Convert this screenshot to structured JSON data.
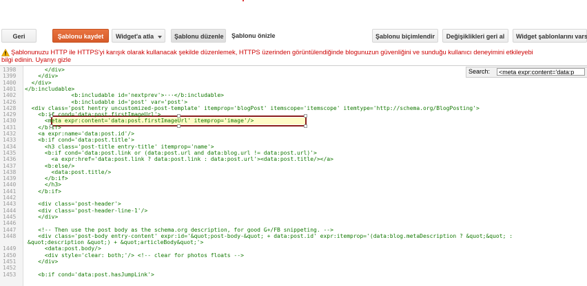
{
  "toolbar": {
    "back": "Geri",
    "save": "Şablonu kaydet",
    "widget_jump": "Widget'a atla",
    "edit_template": "Şablonu düzenle",
    "preview_template": "Şablonu önizle",
    "format_template": "Şablonu biçimlendir",
    "revert_changes": "Değişiklikleri geri al",
    "widget_templates": "Widget şablonlarını varsa"
  },
  "warning": {
    "line1": "Şablonunuzu HTTP ile HTTPS'yi karışık olarak kullanacak şekilde düzenlemek, HTTPS üzerinden görüntülendiğinde blogunuzun güvenliğini ve sunduğu kullanıcı deneyimini etkileyebi",
    "line2": "bilgi edinin.",
    "link": "Uyarıyı gizle"
  },
  "search": {
    "label": "Search:",
    "value": "<meta expr:content='data:p"
  },
  "code": [
    {
      "n": "1398",
      "t": "      </div>"
    },
    {
      "n": "1399",
      "t": "    </div>"
    },
    {
      "n": "1400",
      "t": "  </div>"
    },
    {
      "n": "1401",
      "t": "</b:includable>"
    },
    {
      "n": "1402",
      "t": "              <b:includable id='nextprev'>···</b:includable>"
    },
    {
      "n": "1426",
      "t": "              <b:includable id='post' var='post'>"
    },
    {
      "n": "1428",
      "t": "  <div class='post hentry uncustomized-post-template' itemprop='blogPost' itemscope='itemscope' itemtype='http://schema.org/BlogPosting'>"
    },
    {
      "n": "1429",
      "t": "    <b:if cond='data:post.firstImageUrl'>"
    },
    {
      "n": "1430",
      "t": "      <meta expr:content='data:post.firstImageUrl' itemprop='image'/>"
    },
    {
      "n": "1431",
      "t": "    </b:if>"
    },
    {
      "n": "1432",
      "t": "    <a expr:name='data:post.id'/>"
    },
    {
      "n": "1433",
      "t": "    <b:if cond='data:post.title'>"
    },
    {
      "n": "1434",
      "t": "      <h3 class='post-title entry-title' itemprop='name'>"
    },
    {
      "n": "1435",
      "t": "      <b:if cond='data:post.link or (data:post.url and data:blog.url != data:post.url)'>"
    },
    {
      "n": "1436",
      "t": "        <a expr:href='data:post.link ? data:post.link : data:post.url'><data:post.title/></a>"
    },
    {
      "n": "1437",
      "t": "      <b:else/>"
    },
    {
      "n": "1438",
      "t": "        <data:post.title/>"
    },
    {
      "n": "1439",
      "t": "      </b:if>"
    },
    {
      "n": "1440",
      "t": "      </h3>"
    },
    {
      "n": "1441",
      "t": "    </b:if>"
    },
    {
      "n": "1442",
      "t": ""
    },
    {
      "n": "1443",
      "t": "    <div class='post-header'>"
    },
    {
      "n": "1444",
      "t": "    <div class='post-header-line-1'/>"
    },
    {
      "n": "1445",
      "t": "    </div>"
    },
    {
      "n": "1446",
      "t": ""
    },
    {
      "n": "1447",
      "t": "    <!-- Then use the post body as the schema.org description, for good G+/FB snippeting. -->"
    },
    {
      "n": "1448",
      "t": "    <div class='post-body entry-content' expr:id='&quot;post-body-&quot; + data:post.id' expr:itemprop='(data:blog.metaDescription ? &quot;&quot; :"
    },
    {
      "n": "",
      "t": "&quot;description &quot;) + &quot;articleBody&quot;'>"
    },
    {
      "n": "1449",
      "t": "      <data:post.body/>"
    },
    {
      "n": "1450",
      "t": "      <div style='clear: both;'/> <!-- clear for photos floats -->"
    },
    {
      "n": "1451",
      "t": "    </div>"
    },
    {
      "n": "1452",
      "t": ""
    },
    {
      "n": "1453",
      "t": "    <b:if cond='data:post.hasJumpLink'>"
    }
  ]
}
